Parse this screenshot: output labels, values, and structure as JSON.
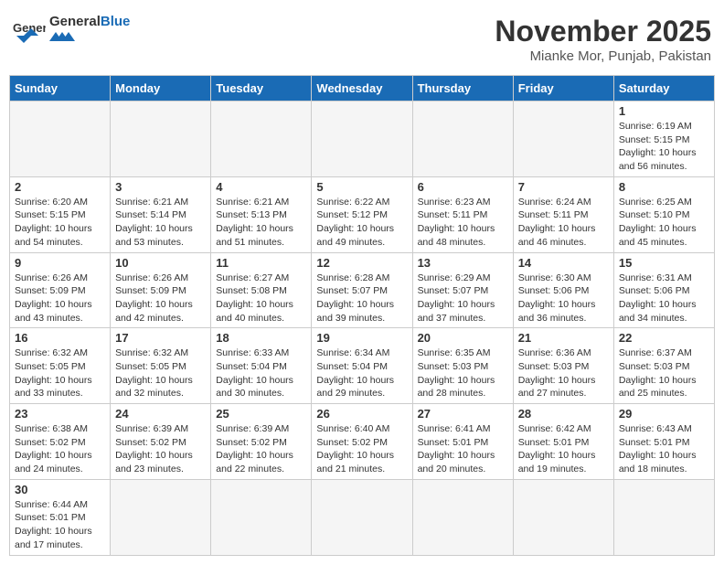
{
  "header": {
    "logo_general": "General",
    "logo_blue": "Blue",
    "month_title": "November 2025",
    "subtitle": "Mianke Mor, Punjab, Pakistan"
  },
  "weekdays": [
    "Sunday",
    "Monday",
    "Tuesday",
    "Wednesday",
    "Thursday",
    "Friday",
    "Saturday"
  ],
  "weeks": [
    [
      {
        "day": "",
        "info": ""
      },
      {
        "day": "",
        "info": ""
      },
      {
        "day": "",
        "info": ""
      },
      {
        "day": "",
        "info": ""
      },
      {
        "day": "",
        "info": ""
      },
      {
        "day": "",
        "info": ""
      },
      {
        "day": "1",
        "info": "Sunrise: 6:19 AM\nSunset: 5:15 PM\nDaylight: 10 hours\nand 56 minutes."
      }
    ],
    [
      {
        "day": "2",
        "info": "Sunrise: 6:20 AM\nSunset: 5:15 PM\nDaylight: 10 hours\nand 54 minutes."
      },
      {
        "day": "3",
        "info": "Sunrise: 6:21 AM\nSunset: 5:14 PM\nDaylight: 10 hours\nand 53 minutes."
      },
      {
        "day": "4",
        "info": "Sunrise: 6:21 AM\nSunset: 5:13 PM\nDaylight: 10 hours\nand 51 minutes."
      },
      {
        "day": "5",
        "info": "Sunrise: 6:22 AM\nSunset: 5:12 PM\nDaylight: 10 hours\nand 49 minutes."
      },
      {
        "day": "6",
        "info": "Sunrise: 6:23 AM\nSunset: 5:11 PM\nDaylight: 10 hours\nand 48 minutes."
      },
      {
        "day": "7",
        "info": "Sunrise: 6:24 AM\nSunset: 5:11 PM\nDaylight: 10 hours\nand 46 minutes."
      },
      {
        "day": "8",
        "info": "Sunrise: 6:25 AM\nSunset: 5:10 PM\nDaylight: 10 hours\nand 45 minutes."
      }
    ],
    [
      {
        "day": "9",
        "info": "Sunrise: 6:26 AM\nSunset: 5:09 PM\nDaylight: 10 hours\nand 43 minutes."
      },
      {
        "day": "10",
        "info": "Sunrise: 6:26 AM\nSunset: 5:09 PM\nDaylight: 10 hours\nand 42 minutes."
      },
      {
        "day": "11",
        "info": "Sunrise: 6:27 AM\nSunset: 5:08 PM\nDaylight: 10 hours\nand 40 minutes."
      },
      {
        "day": "12",
        "info": "Sunrise: 6:28 AM\nSunset: 5:07 PM\nDaylight: 10 hours\nand 39 minutes."
      },
      {
        "day": "13",
        "info": "Sunrise: 6:29 AM\nSunset: 5:07 PM\nDaylight: 10 hours\nand 37 minutes."
      },
      {
        "day": "14",
        "info": "Sunrise: 6:30 AM\nSunset: 5:06 PM\nDaylight: 10 hours\nand 36 minutes."
      },
      {
        "day": "15",
        "info": "Sunrise: 6:31 AM\nSunset: 5:06 PM\nDaylight: 10 hours\nand 34 minutes."
      }
    ],
    [
      {
        "day": "16",
        "info": "Sunrise: 6:32 AM\nSunset: 5:05 PM\nDaylight: 10 hours\nand 33 minutes."
      },
      {
        "day": "17",
        "info": "Sunrise: 6:32 AM\nSunset: 5:05 PM\nDaylight: 10 hours\nand 32 minutes."
      },
      {
        "day": "18",
        "info": "Sunrise: 6:33 AM\nSunset: 5:04 PM\nDaylight: 10 hours\nand 30 minutes."
      },
      {
        "day": "19",
        "info": "Sunrise: 6:34 AM\nSunset: 5:04 PM\nDaylight: 10 hours\nand 29 minutes."
      },
      {
        "day": "20",
        "info": "Sunrise: 6:35 AM\nSunset: 5:03 PM\nDaylight: 10 hours\nand 28 minutes."
      },
      {
        "day": "21",
        "info": "Sunrise: 6:36 AM\nSunset: 5:03 PM\nDaylight: 10 hours\nand 27 minutes."
      },
      {
        "day": "22",
        "info": "Sunrise: 6:37 AM\nSunset: 5:03 PM\nDaylight: 10 hours\nand 25 minutes."
      }
    ],
    [
      {
        "day": "23",
        "info": "Sunrise: 6:38 AM\nSunset: 5:02 PM\nDaylight: 10 hours\nand 24 minutes."
      },
      {
        "day": "24",
        "info": "Sunrise: 6:39 AM\nSunset: 5:02 PM\nDaylight: 10 hours\nand 23 minutes."
      },
      {
        "day": "25",
        "info": "Sunrise: 6:39 AM\nSunset: 5:02 PM\nDaylight: 10 hours\nand 22 minutes."
      },
      {
        "day": "26",
        "info": "Sunrise: 6:40 AM\nSunset: 5:02 PM\nDaylight: 10 hours\nand 21 minutes."
      },
      {
        "day": "27",
        "info": "Sunrise: 6:41 AM\nSunset: 5:01 PM\nDaylight: 10 hours\nand 20 minutes."
      },
      {
        "day": "28",
        "info": "Sunrise: 6:42 AM\nSunset: 5:01 PM\nDaylight: 10 hours\nand 19 minutes."
      },
      {
        "day": "29",
        "info": "Sunrise: 6:43 AM\nSunset: 5:01 PM\nDaylight: 10 hours\nand 18 minutes."
      }
    ],
    [
      {
        "day": "30",
        "info": "Sunrise: 6:44 AM\nSunset: 5:01 PM\nDaylight: 10 hours\nand 17 minutes."
      },
      {
        "day": "",
        "info": ""
      },
      {
        "day": "",
        "info": ""
      },
      {
        "day": "",
        "info": ""
      },
      {
        "day": "",
        "info": ""
      },
      {
        "day": "",
        "info": ""
      },
      {
        "day": "",
        "info": ""
      }
    ]
  ]
}
